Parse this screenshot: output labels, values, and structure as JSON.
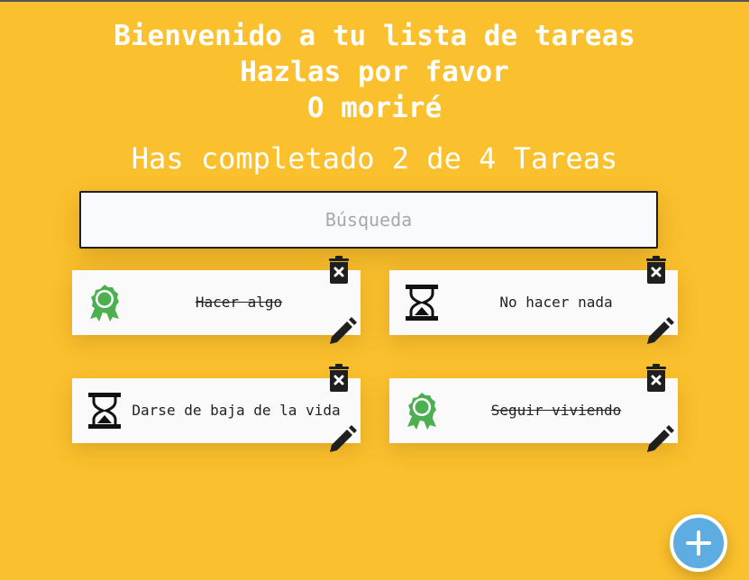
{
  "header": {
    "title_line1": "Bienvenido a tu lista de tareas",
    "title_line2": "Hazlas por favor",
    "title_line3": "O moriré",
    "counter": "Has completado 2 de 4 Tareas"
  },
  "search": {
    "placeholder": "Búsqueda",
    "value": ""
  },
  "todos": [
    {
      "text": "Hacer algo",
      "completed": true
    },
    {
      "text": "No hacer nada",
      "completed": false
    },
    {
      "text": "Darse de baja de la vida",
      "completed": false
    },
    {
      "text": "Seguir viviendo",
      "completed": true
    }
  ],
  "icons": {
    "completed": "award-ribbon-icon",
    "pending": "hourglass-icon",
    "delete": "trash-icon",
    "edit": "pencil-icon",
    "add": "plus-icon"
  },
  "colors": {
    "background": "#fbc02d",
    "award": "#4caf50",
    "fab": "#5dade2"
  }
}
